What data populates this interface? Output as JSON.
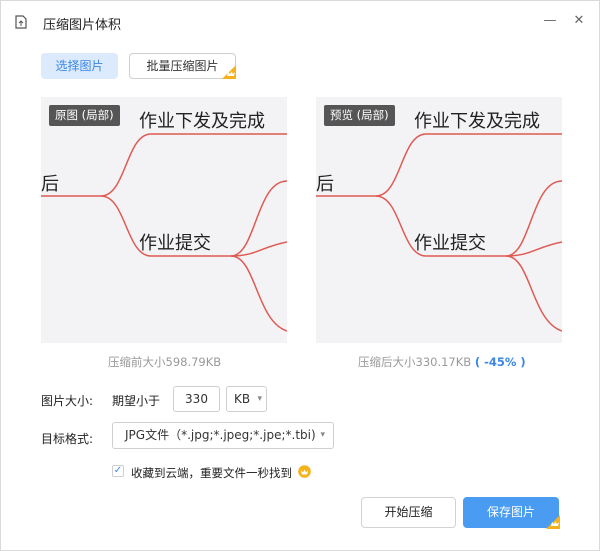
{
  "window": {
    "title": "压缩图片体积",
    "minimize_glyph": "—",
    "close_glyph": "✕"
  },
  "toolbar": {
    "select_label": "选择图片",
    "batch_label": "批量压缩图片"
  },
  "original": {
    "tag": "原图 (局部)",
    "caption": "压缩前大小598.79KB"
  },
  "preview": {
    "tag": "预览 (局部)",
    "caption": "压缩后大小330.17KB",
    "percent": "( -45% )"
  },
  "mindmap": {
    "node_top": "作业下发及完成",
    "node_mid": "作业提交",
    "node_left": "后"
  },
  "settings": {
    "size_label": "图片大小:",
    "expect_label": "期望小于",
    "size_value": "330",
    "unit": "KB",
    "format_label": "目标格式:",
    "format_value": "JPG文件（*.jpg;*.jpeg;*.jpe;*.tbi)",
    "cloud_checked": true,
    "cloud_label": "收藏到云端，重要文件一秒找到"
  },
  "actions": {
    "start_label": "开始压缩",
    "save_label": "保存图片"
  },
  "colors": {
    "accent": "#4a9cf2",
    "accent_light": "#dbeafc",
    "crown": "#f5b21b",
    "branch": "#e05a54",
    "panel_bg": "#f3f2f5"
  },
  "icons": [
    "document-icon",
    "minimize-icon",
    "close-icon",
    "crown-icon",
    "vip-icon",
    "check-icon",
    "chevron-down-icon"
  ]
}
